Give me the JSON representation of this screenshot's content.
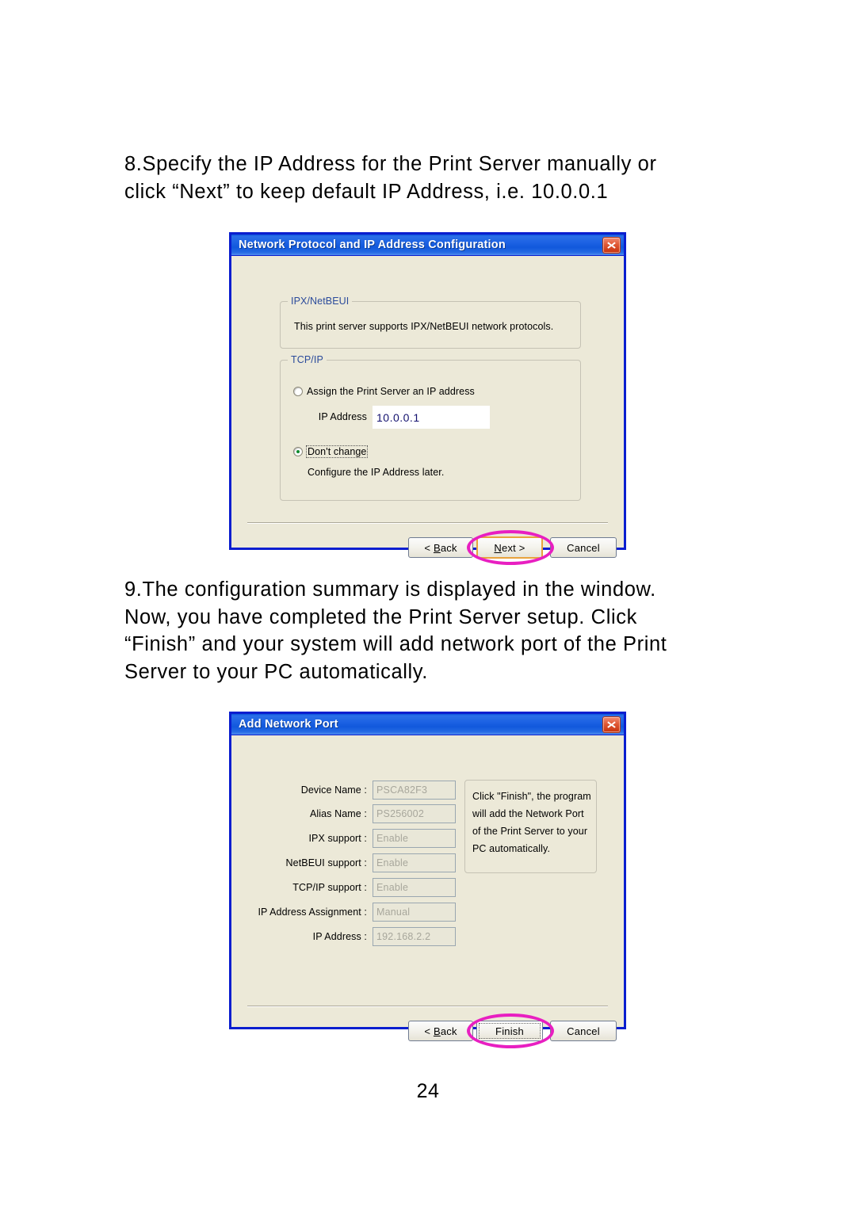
{
  "page": {
    "number": "24"
  },
  "steps": [
    {
      "name": "step-8",
      "lines": [
        "8.Specify the IP Address for the Print Server manually or",
        "click “Next” to keep default IP Address, i.e. 10.0.0.1"
      ]
    },
    {
      "name": "step-9",
      "lines": [
        "9.The configuration summary is displayed in the window.",
        "Now, you have completed the Print Server setup. Click",
        "“Finish” and your system will add network port of the Print",
        "Server to your PC automatically."
      ]
    }
  ],
  "dialog1": {
    "title": "Network Protocol and IP Address Configuration",
    "close_icon": "close-icon",
    "groups": {
      "ipx": {
        "legend": "IPX/NetBEUI",
        "text": "This print server supports IPX/NetBEUI network protocols."
      },
      "tcpip": {
        "legend": "TCP/IP",
        "radio_assign": {
          "label": "Assign the Print Server an IP address",
          "checked": false
        },
        "ip_address_label": "IP Address",
        "ip_address_value": "10.0.0.1",
        "radio_dontchange": {
          "label": "Don't change",
          "checked": true
        },
        "dontchange_note": "Configure the IP Address later."
      }
    },
    "buttons": {
      "back": "< Back",
      "back_accel": "B",
      "next": "Next >",
      "next_accel": "N",
      "cancel": "Cancel"
    },
    "annotation": {
      "target": "next-button",
      "color": "#e81fc1"
    }
  },
  "dialog2": {
    "title": "Add Network Port",
    "close_icon": "close-icon",
    "fields": [
      {
        "label": "Device Name :",
        "value": "PSCA82F3"
      },
      {
        "label": "Alias Name :",
        "value": "PS256002"
      },
      {
        "label": "IPX support :",
        "value": "Enable"
      },
      {
        "label": "NetBEUI support :",
        "value": "Enable"
      },
      {
        "label": "TCP/IP support :",
        "value": "Enable"
      },
      {
        "label": "IP Address Assignment :",
        "value": "Manual"
      },
      {
        "label": "IP Address :",
        "value": "192.168.2.2"
      }
    ],
    "infobox": {
      "lines": [
        "Click \"Finish\", the program",
        "will add the Network Port",
        "of the Print Server to your",
        "PC automatically."
      ]
    },
    "buttons": {
      "back": "< Back",
      "back_accel": "B",
      "finish": "Finish",
      "cancel": "Cancel"
    },
    "annotation": {
      "target": "finish-button",
      "color": "#e81fc1"
    }
  }
}
